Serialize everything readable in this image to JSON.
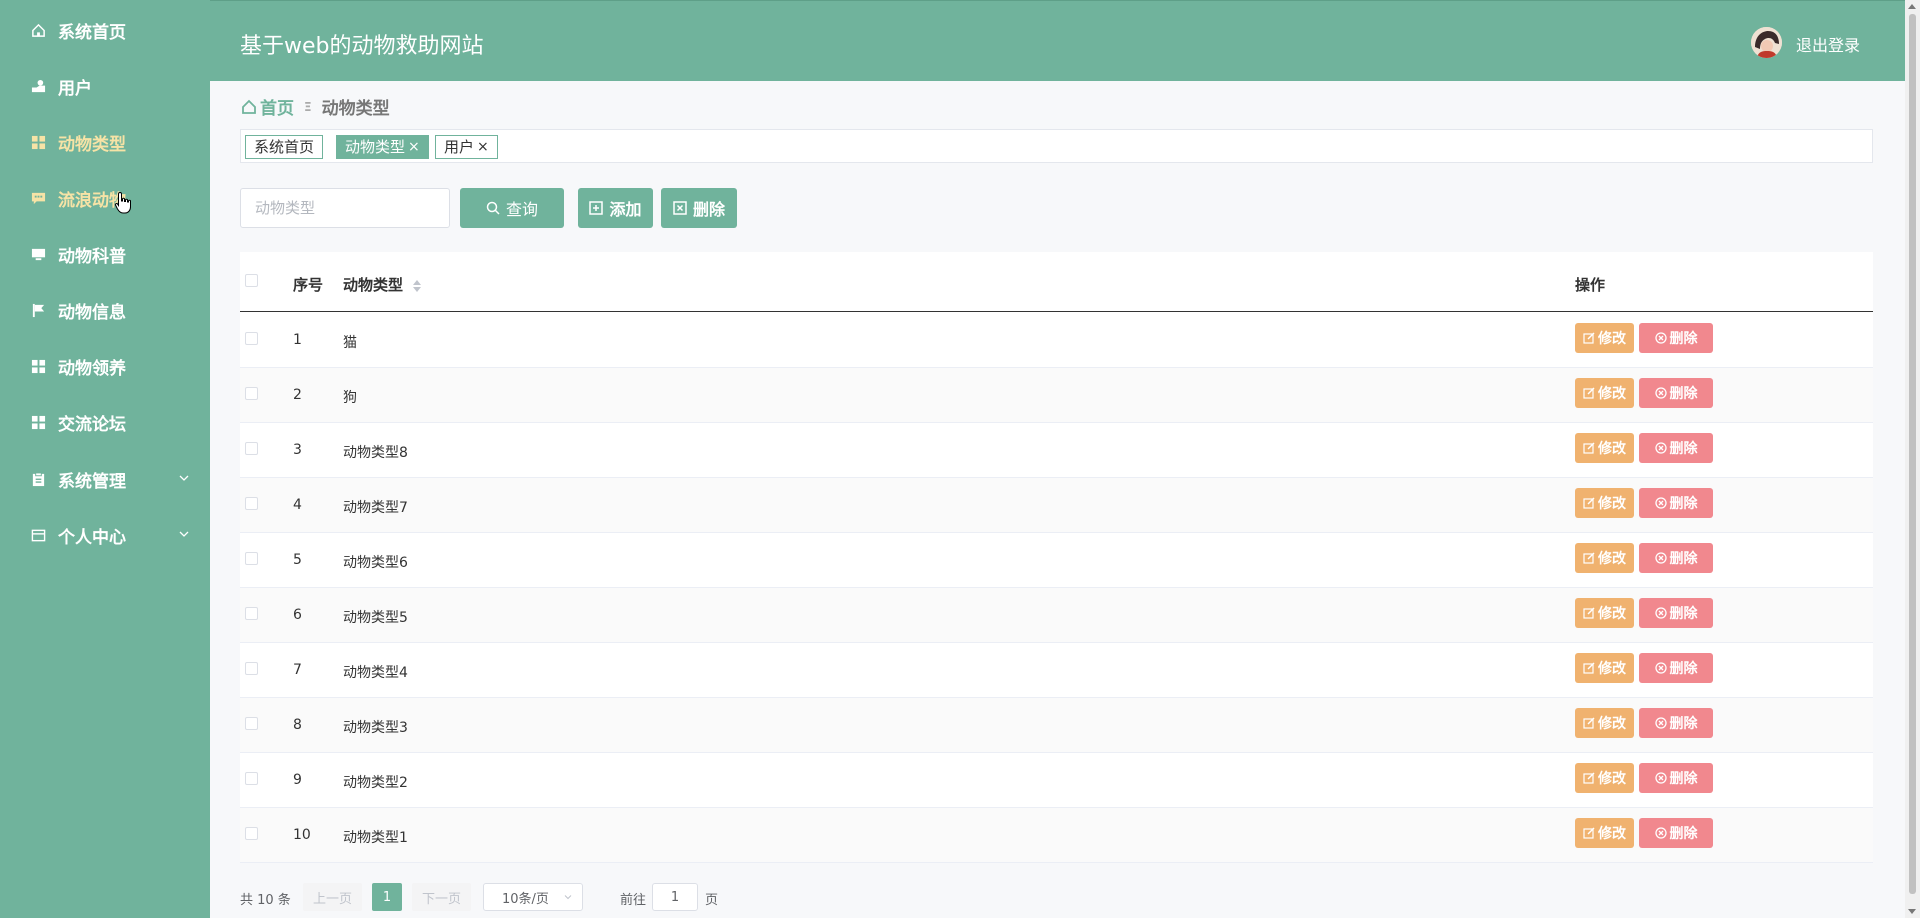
{
  "header": {
    "title": "基于web的动物救助网站",
    "logout_label": "退出登录"
  },
  "sidebar": {
    "items": [
      {
        "label": "系统首页",
        "icon": "home-icon"
      },
      {
        "label": "用户",
        "icon": "user-icon"
      },
      {
        "label": "动物类型",
        "icon": "grid-icon"
      },
      {
        "label": "流浪动物",
        "icon": "chat-icon"
      },
      {
        "label": "动物科普",
        "icon": "monitor-icon"
      },
      {
        "label": "动物信息",
        "icon": "flag-icon"
      },
      {
        "label": "动物领养",
        "icon": "grid-icon"
      },
      {
        "label": "交流论坛",
        "icon": "grid-icon"
      },
      {
        "label": "系统管理",
        "icon": "clipboard-icon"
      },
      {
        "label": "个人中心",
        "icon": "card-icon"
      }
    ]
  },
  "breadcrumb": {
    "home": "首页",
    "separator": "Ξ",
    "current": "动物类型"
  },
  "tags": [
    {
      "label": "系统首页"
    },
    {
      "label": "动物类型",
      "close": "×"
    },
    {
      "label": "用户",
      "close": "×"
    }
  ],
  "search": {
    "placeholder": "动物类型",
    "query_label": "查询",
    "add_label": "添加",
    "delete_label": "删除"
  },
  "table": {
    "columns": {
      "index": "序号",
      "type": "动物类型",
      "actions": "操作"
    },
    "edit_label": "修改",
    "delete_label": "删除",
    "rows": [
      {
        "index": "1",
        "type": "猫"
      },
      {
        "index": "2",
        "type": "狗"
      },
      {
        "index": "3",
        "type": "动物类型8"
      },
      {
        "index": "4",
        "type": "动物类型7"
      },
      {
        "index": "5",
        "type": "动物类型6"
      },
      {
        "index": "6",
        "type": "动物类型5"
      },
      {
        "index": "7",
        "type": "动物类型4"
      },
      {
        "index": "8",
        "type": "动物类型3"
      },
      {
        "index": "9",
        "type": "动物类型2"
      },
      {
        "index": "10",
        "type": "动物类型1"
      }
    ]
  },
  "pagination": {
    "total": "共 10 条",
    "prev": "上一页",
    "current": "1",
    "next": "下一页",
    "page_size": "10条/页",
    "goto_prefix": "前往",
    "goto_value": "1",
    "goto_suffix": "页"
  },
  "colors": {
    "primary": "#70b39c",
    "active_menu": "#f6e3a6",
    "edit": "#f0b26f",
    "delete": "#f1888e"
  }
}
